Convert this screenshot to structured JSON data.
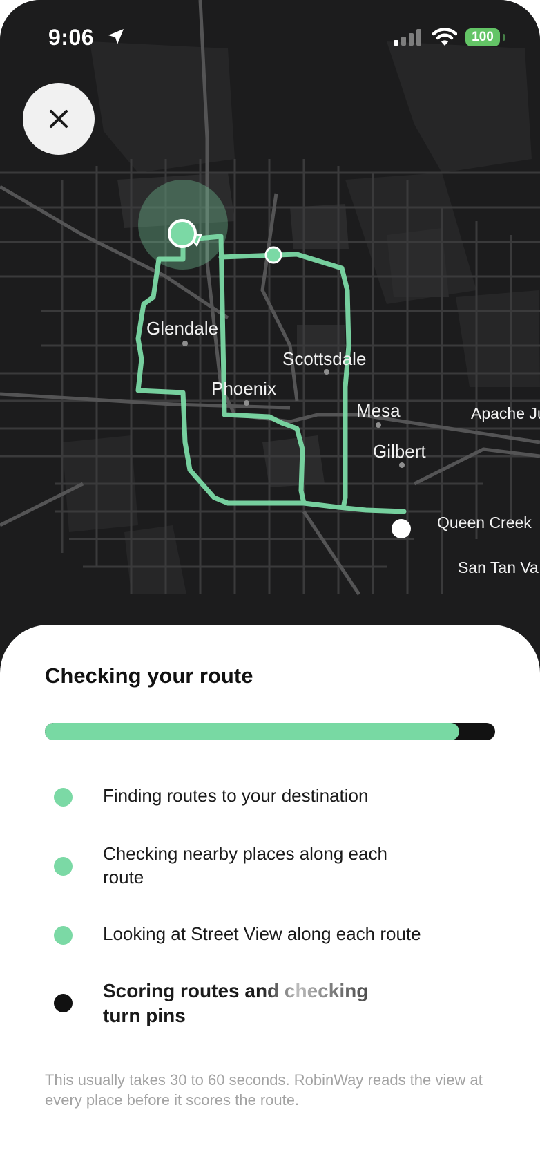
{
  "status_bar": {
    "time": "9:06",
    "battery": "100",
    "icons": [
      "location-arrow-icon",
      "signal-bars-icon",
      "wifi-icon",
      "battery-icon"
    ]
  },
  "close_button": {
    "icon": "close-icon"
  },
  "map": {
    "cities": [
      "Glendale",
      "Phoenix",
      "Scottsdale",
      "Mesa",
      "Gilbert",
      "Apache Ju",
      "Queen Creek",
      "San Tan Va"
    ],
    "route_color": "#7bd9a5",
    "background": "#1c1c1d"
  },
  "sheet": {
    "title": "Checking your route",
    "progress_percent": 92,
    "accent": "#78d9a3",
    "steps": [
      {
        "label": "Finding routes to your destination",
        "state": "done"
      },
      {
        "label": "Checking nearby places along each route",
        "state": "done"
      },
      {
        "label": "Looking at Street View along each route",
        "state": "done"
      },
      {
        "label": "Scoring routes and checking turn pins",
        "state": "active"
      }
    ],
    "footnote": "This usually takes 30 to 60 seconds. RobinWay reads the view at every place before it scores the route."
  }
}
